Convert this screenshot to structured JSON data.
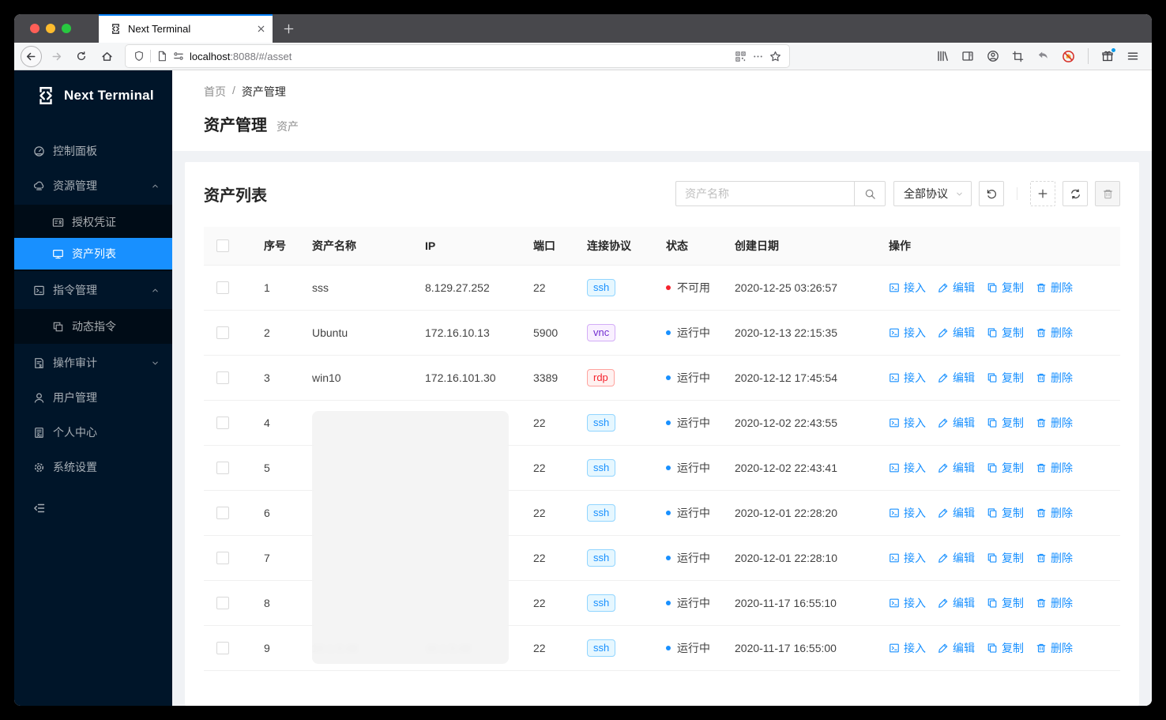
{
  "browser": {
    "tab_title": "Next Terminal",
    "url": {
      "host": "localhost",
      "rest": ":8088/#/asset"
    },
    "traffic_colors": {
      "close": "#ff5f57",
      "minimize": "#febc2e",
      "zoom": "#28c840"
    }
  },
  "sidebar": {
    "logo_text": "Next Terminal",
    "items": [
      {
        "label": "控制面板",
        "icon": "dashboard-icon"
      },
      {
        "label": "资源管理",
        "icon": "cloud-server-icon",
        "state": "expanded"
      },
      {
        "label": "授权凭证",
        "icon": "idcard-icon",
        "submenu": true
      },
      {
        "label": "资产列表",
        "icon": "desktop-icon",
        "submenu": true,
        "active": true
      },
      {
        "label": "指令管理",
        "icon": "code-icon",
        "state": "expanded"
      },
      {
        "label": "动态指令",
        "icon": "block-icon",
        "submenu": true
      },
      {
        "label": "操作审计",
        "icon": "audit-icon",
        "state": "collapsed"
      },
      {
        "label": "用户管理",
        "icon": "user-icon"
      },
      {
        "label": "个人中心",
        "icon": "solution-icon"
      },
      {
        "label": "系统设置",
        "icon": "setting-icon"
      }
    ]
  },
  "page": {
    "breadcrumb": {
      "home": "首页",
      "separator": "/",
      "current": "资产管理"
    },
    "title": "资产管理",
    "subtitle": "资产"
  },
  "card": {
    "title": "资产列表",
    "search_placeholder": "资产名称",
    "protocol_filter": "全部协议"
  },
  "table": {
    "headers": {
      "index": "序号",
      "name": "资产名称",
      "ip": "IP",
      "port": "端口",
      "protocol": "连接协议",
      "status": "状态",
      "created": "创建日期",
      "actions": "操作"
    },
    "actions": {
      "connect": "接入",
      "edit": "编辑",
      "copy": "复制",
      "delete": "删除"
    },
    "rows": [
      {
        "index": "1",
        "name": "sss",
        "ip": "8.129.27.252",
        "port": "22",
        "protocol": "ssh",
        "status": "不可用",
        "created": "2020-12-25 03:26:57"
      },
      {
        "index": "2",
        "name": "Ubuntu",
        "ip": "172.16.10.13",
        "port": "5900",
        "protocol": "vnc",
        "status": "运行中",
        "created": "2020-12-13 22:15:35"
      },
      {
        "index": "3",
        "name": "win10",
        "ip": "172.16.101.30",
        "port": "3389",
        "protocol": "rdp",
        "status": "运行中",
        "created": "2020-12-12 17:45:54"
      },
      {
        "index": "4",
        "name": "",
        "ip": "",
        "port": "22",
        "protocol": "ssh",
        "status": "运行中",
        "created": "2020-12-02 22:43:55"
      },
      {
        "index": "5",
        "name": "",
        "ip": "",
        "port": "22",
        "protocol": "ssh",
        "status": "运行中",
        "created": "2020-12-02 22:43:41"
      },
      {
        "index": "6",
        "name": "",
        "ip": "",
        "port": "22",
        "protocol": "ssh",
        "status": "运行中",
        "created": "2020-12-01 22:28:20"
      },
      {
        "index": "7",
        "name": "",
        "ip": "",
        "port": "22",
        "protocol": "ssh",
        "status": "运行中",
        "created": "2020-12-01 22:28:10"
      },
      {
        "index": "8",
        "name": "",
        "ip": "",
        "port": "22",
        "protocol": "ssh",
        "status": "运行中",
        "created": "2020-11-17 16:55:10"
      },
      {
        "index": "9",
        "name": "10.1.5.49",
        "ip": "10.1.5.49",
        "port": "22",
        "protocol": "ssh",
        "status": "运行中",
        "created": "2020-11-17 16:55:00"
      }
    ]
  },
  "colors": {
    "accent": "#1890ff",
    "sidebar_bg": "#001529",
    "submenu_bg": "#000c17",
    "status_running": "#1890ff",
    "status_unavailable": "#f5222d",
    "tag_ssh": {
      "text": "#1890ff",
      "bg": "#e6f7ff",
      "border": "#91d5ff"
    },
    "tag_vnc": {
      "text": "#722ed1",
      "bg": "#f9f0ff",
      "border": "#d3adf7"
    },
    "tag_rdp": {
      "text": "#f5222d",
      "bg": "#fff1f0",
      "border": "#ffa39e"
    }
  },
  "icons": {
    "search-icon": "magnifier",
    "reset-icon": "undo-circle",
    "add-icon": "plus",
    "refresh-icon": "sync-arrows",
    "delete-icon": "trash",
    "connect-icon": "terminal-square",
    "edit-icon": "pen",
    "copy-icon": "two-sheets"
  }
}
